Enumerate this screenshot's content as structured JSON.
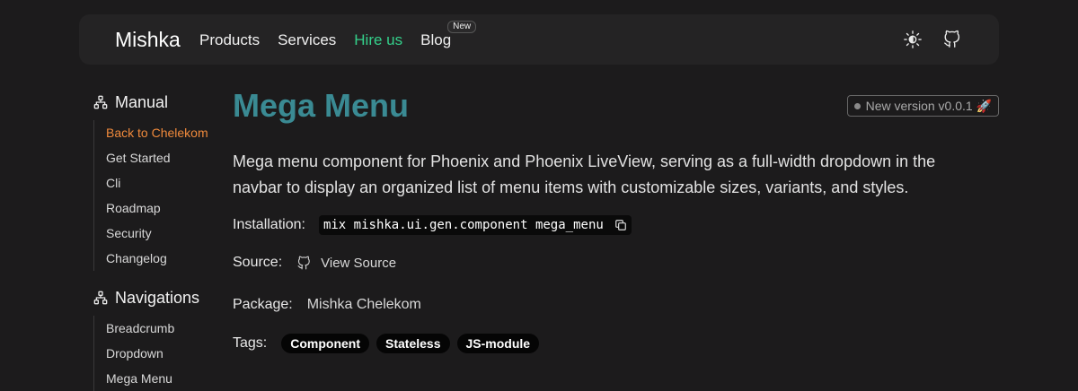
{
  "header": {
    "brand": "Mishka",
    "links": [
      "Products",
      "Services",
      "Hire us",
      "Blog"
    ],
    "blog_badge": "New",
    "theme_icon": "sun-icon",
    "github_icon": "github-icon",
    "accent_hire": "#34d08b"
  },
  "sidebar": {
    "sections": [
      {
        "title": "Manual",
        "icon": "network-icon",
        "items": [
          "Back to Chelekom",
          "Get Started",
          "Cli",
          "Roadmap",
          "Security",
          "Changelog"
        ]
      },
      {
        "title": "Navigations",
        "icon": "network-icon",
        "items": [
          "Breadcrumb",
          "Dropdown",
          "Mega Menu"
        ]
      }
    ],
    "active_color": "#f08a3c"
  },
  "main": {
    "title": "Mega Menu",
    "title_color": "#3a8a93",
    "version": "New version v0.0.1 🚀",
    "description": "Mega menu component for Phoenix and Phoenix LiveView, serving as a full-width dropdown in the navbar to display an organized list of menu items with customizable sizes, variants, and styles.",
    "installation_label": "Installation:",
    "installation_cmd": "mix mishka.ui.gen.component mega_menu",
    "source_label": "Source:",
    "source_link": "View Source",
    "package_label": "Package:",
    "package_value": "Mishka Chelekom",
    "tags_label": "Tags:",
    "tags": [
      "Component",
      "Stateless",
      "JS-module"
    ]
  }
}
